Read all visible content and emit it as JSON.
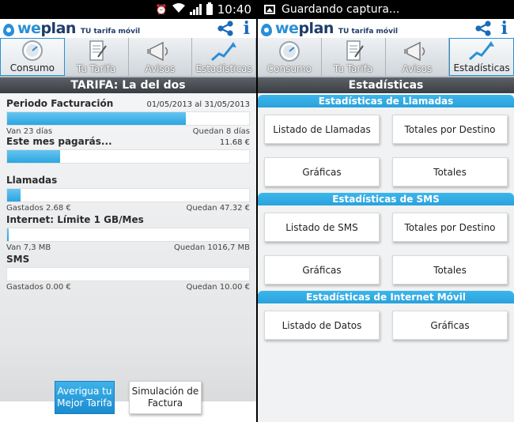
{
  "left": {
    "status": {
      "time": "10:40"
    },
    "app": {
      "logo_we": "we",
      "logo_plan": "plan",
      "tagline": "TU tarifa móvil"
    },
    "tabs": [
      {
        "label": "Consumo",
        "icon": "speedometer-icon",
        "active": true
      },
      {
        "label": "Tu Tarifa",
        "icon": "document-icon",
        "active": false
      },
      {
        "label": "Avisos",
        "icon": "megaphone-icon",
        "active": false
      },
      {
        "label": "Estadísticas",
        "icon": "trend-chart-icon",
        "active": false
      }
    ],
    "tariff_title": "TARIFA: La del dos",
    "periodo": {
      "label": "Periodo Facturación",
      "range": "01/05/2013 al 31/05/2013",
      "progress": 0.74,
      "left_text": "Van 23 días",
      "right_text": "Quedan 8 días"
    },
    "pagaras": {
      "label": "Este mes pagarás...",
      "amount": "11.68 €",
      "progress": 0.22
    },
    "llamadas": {
      "label": "Llamadas",
      "progress": 0.054,
      "left_text": "Gastados 2.68 €",
      "right_text": "Quedan 47.32 €"
    },
    "internet": {
      "label": "Internet: Límite 1 GB/Mes",
      "progress": 0.007,
      "left_text": "Van 7,3 MB",
      "right_text": "Quedan 1016,7 MB"
    },
    "sms": {
      "label": "SMS",
      "progress": 0.0,
      "left_text": "Gastados 0.00 €",
      "right_text": "Quedan 10.00 €"
    },
    "buttons": {
      "averigua": "Averigua tu Mejor Tarifa",
      "simulacion": "Simulación de Factura"
    }
  },
  "right": {
    "status": {
      "notification": "Guardando captura..."
    },
    "app": {
      "logo_we": "we",
      "logo_plan": "plan",
      "tagline": "TU tarifa móvil"
    },
    "tabs": [
      {
        "label": "Consumo",
        "icon": "speedometer-icon",
        "active": false
      },
      {
        "label": "Tu Tarifa",
        "icon": "document-icon",
        "active": false
      },
      {
        "label": "Avisos",
        "icon": "megaphone-icon",
        "active": false
      },
      {
        "label": "Estadísticas",
        "icon": "trend-chart-icon",
        "active": true
      }
    ],
    "title": "Estadísticas",
    "sections": {
      "llamadas": {
        "title": "Estadísticas de Llamadas",
        "buttons": [
          "Listado de Llamadas",
          "Totales por Destino",
          "Gráficas",
          "Totales"
        ]
      },
      "sms": {
        "title": "Estadísticas de SMS",
        "buttons": [
          "Listado de SMS",
          "Totales por Destino",
          "Gráficas",
          "Totales"
        ]
      },
      "internet": {
        "title": "Estadísticas de Internet Móvil",
        "buttons": [
          "Listado de Datos",
          "Gráficas"
        ]
      }
    }
  },
  "colors": {
    "accent": "#2aa1dc",
    "brand_dark": "#1f3d68",
    "header_bar": "#4a4e53"
  }
}
